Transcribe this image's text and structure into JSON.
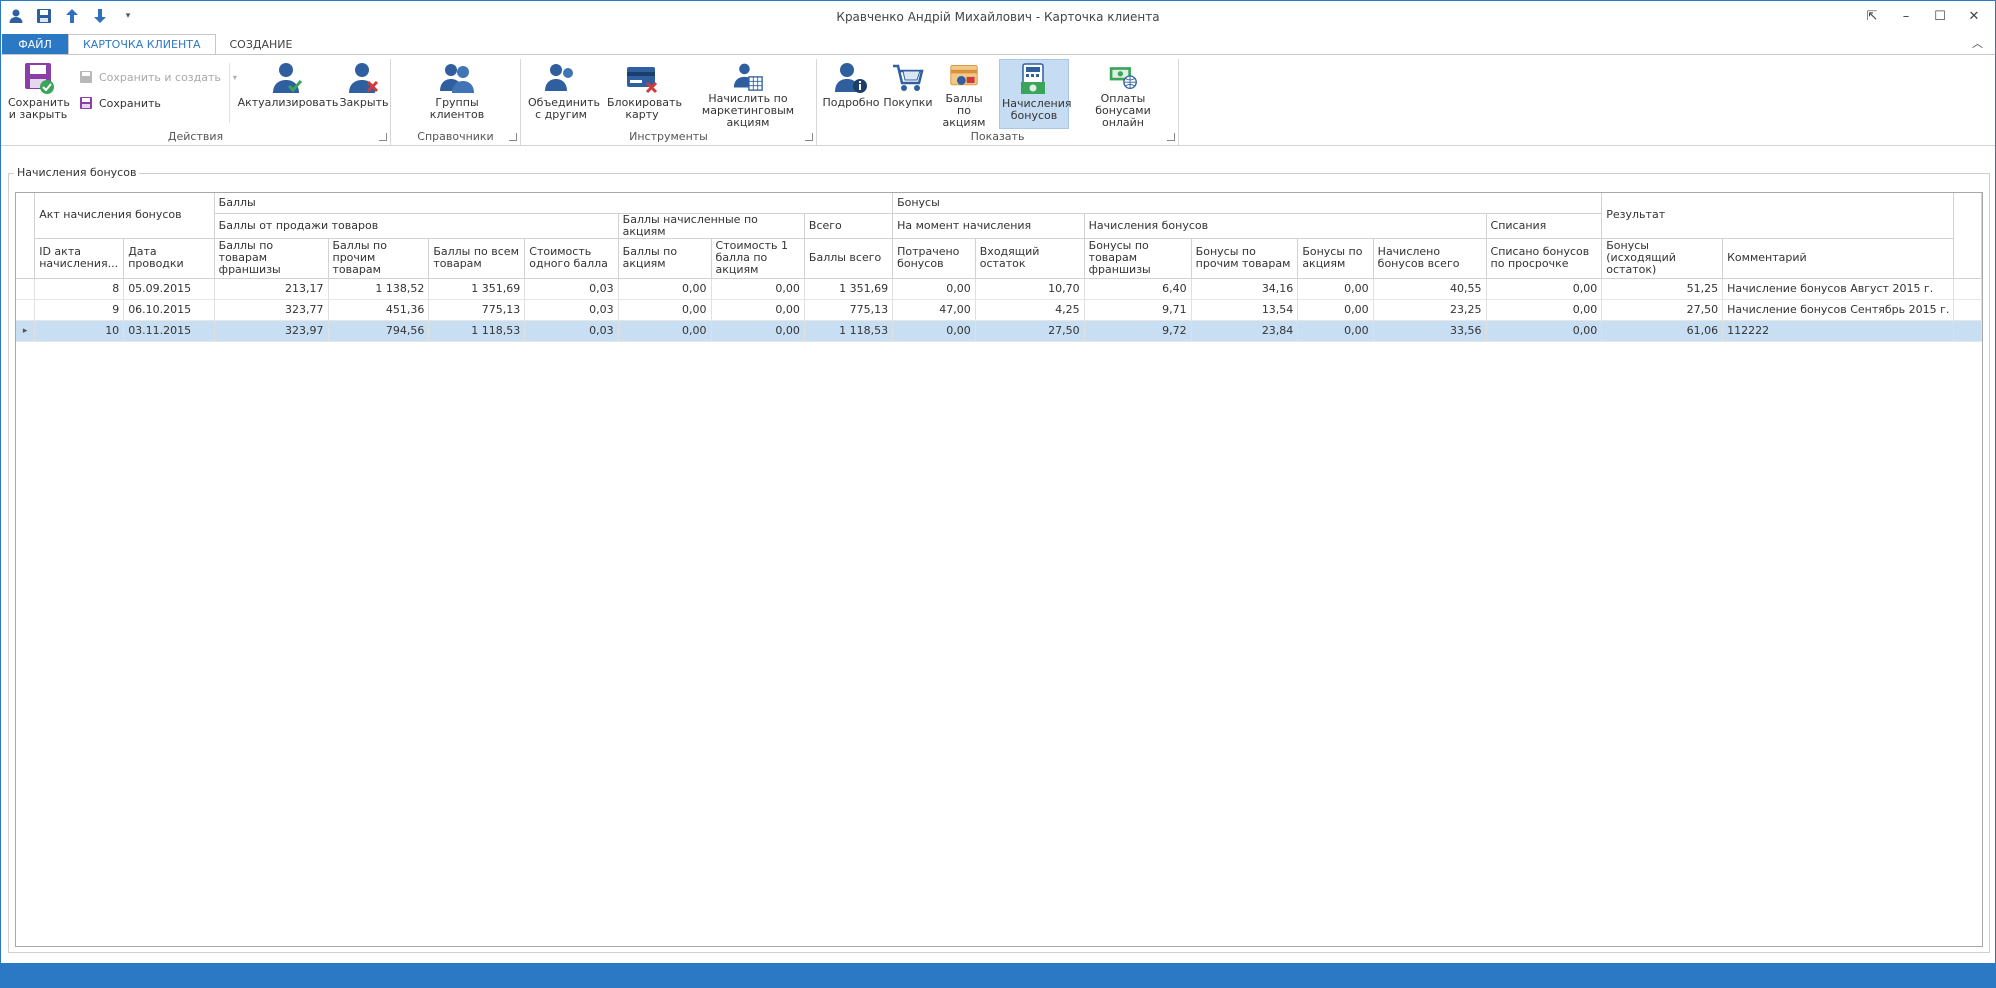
{
  "window": {
    "title": "Кравченко Андрій Михайлович - Карточка клиента",
    "controls": [
      "⇱",
      "–",
      "☐",
      "✕"
    ]
  },
  "ribbon_tabs": [
    {
      "label": "ФАЙЛ"
    },
    {
      "label": "КАРТОЧКА КЛИЕНТА"
    },
    {
      "label": "СОЗДАНИЕ"
    }
  ],
  "ribbon": {
    "groups": {
      "actions": "Действия",
      "references": "Справочники",
      "tools": "Инструменты",
      "show": "Показать"
    },
    "save_close": "Сохранить и закрыть",
    "save_create": "Сохранить и создать",
    "save": "Сохранить",
    "refresh": "Актуализировать",
    "close": "Закрыть",
    "client_groups": "Группы клиентов",
    "merge": "Объединить с другим",
    "block_card": "Блокировать карту",
    "accrue_marketing": "Начислить по маркетинговым акциям",
    "details": "Подробно",
    "purchases": "Покупки",
    "promo_points": "Баллы по акциям",
    "bonus_accruals": "Начисления бонусов",
    "online_payments": "Оплаты бонусами онлайн"
  },
  "panel_title": "Начисления бонусов",
  "grid": {
    "band1": {
      "act": "Акт начисления бонусов",
      "points": "Баллы",
      "bonuses": "Бонусы",
      "result": "Результат"
    },
    "band2": {
      "sale_points": "Баллы от продажи товаров",
      "promo_points": "Баллы начисленные по акциям",
      "total": "Всего",
      "at_moment": "На момент начисления",
      "accrual": "Начисления бонусов",
      "writeoff": "Списания"
    },
    "columns": [
      "ID акта начисления...",
      "Дата проводки",
      "Баллы по товарам франшизы",
      "Баллы по прочим товарам",
      "Баллы по всем товарам",
      "Стоимость одного балла",
      "Баллы по акциям",
      "Стоимость 1 балла по акциям",
      "Баллы всего",
      "Потрачено бонусов",
      "Входящий остаток",
      "Бонусы по товарам франшизы",
      "Бонусы по прочим товарам",
      "Бонусы по акциям",
      "Начислено бонусов всего",
      "Списано бонусов по просрочке",
      "Бонусы (исходящий остаток)",
      "Комментарий"
    ],
    "rows": [
      [
        "8",
        "05.09.2015",
        "213,17",
        "1 138,52",
        "1 351,69",
        "0,03",
        "0,00",
        "0,00",
        "1 351,69",
        "0,00",
        "10,70",
        "6,40",
        "34,16",
        "0,00",
        "40,55",
        "0,00",
        "51,25",
        "Начисление бонусов Август 2015 г."
      ],
      [
        "9",
        "06.10.2015",
        "323,77",
        "451,36",
        "775,13",
        "0,03",
        "0,00",
        "0,00",
        "775,13",
        "47,00",
        "4,25",
        "9,71",
        "13,54",
        "0,00",
        "23,25",
        "0,00",
        "27,50",
        "Начисление бонусов Сентябрь 2015 г."
      ],
      [
        "10",
        "03.11.2015",
        "323,97",
        "794,56",
        "1 118,53",
        "0,03",
        "0,00",
        "0,00",
        "1 118,53",
        "0,00",
        "27,50",
        "9,72",
        "23,84",
        "0,00",
        "33,56",
        "0,00",
        "61,06",
        "112222"
      ]
    ],
    "selected_row": 2
  },
  "colors": {
    "accent": "#2b78c5",
    "selection": "#c7def3"
  }
}
